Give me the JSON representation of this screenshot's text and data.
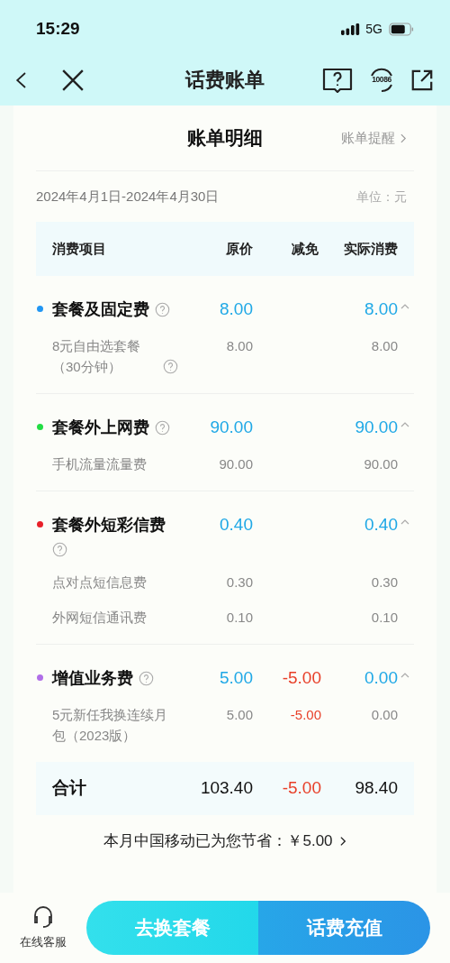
{
  "status_bar": {
    "time": "15:29",
    "network": "5G"
  },
  "nav": {
    "title": "话费账单",
    "service_number": "10086"
  },
  "bill": {
    "title": "账单明细",
    "reminder_link": "账单提醒",
    "period": "2024年4月1日-2024年4月30日",
    "unit": "单位：元",
    "columns": [
      "消费项目",
      "原价",
      "减免",
      "实际消费"
    ],
    "categories": [
      {
        "name": "套餐及固定费",
        "color": "#2196f3",
        "original": "8.00",
        "actual": "8.00",
        "expanded": true,
        "items": [
          {
            "name": "8元自由选套餐（30分钟）",
            "original": "8.00",
            "actual": "8.00",
            "help": true
          }
        ]
      },
      {
        "name": "套餐外上网费",
        "color": "#22dd44",
        "original": "90.00",
        "actual": "90.00",
        "expanded": true,
        "items": [
          {
            "name": "手机流量流量费",
            "original": "90.00",
            "actual": "90.00",
            "help": false
          }
        ]
      },
      {
        "name": "套餐外短彩信费",
        "color": "#e8202a",
        "original": "0.40",
        "actual": "0.40",
        "expanded": true,
        "items": [
          {
            "name": "点对点短信息费",
            "original": "0.30",
            "actual": "0.30",
            "help": false
          },
          {
            "name": "外网短信通讯费",
            "original": "0.10",
            "actual": "0.10",
            "help": false
          }
        ]
      },
      {
        "name": "增值业务费",
        "color": "#b06ee8",
        "original": "5.00",
        "discount": "-5.00",
        "actual": "0.00",
        "expanded": true,
        "items": [
          {
            "name": "5元新任我换连续月包（2023版）",
            "original": "5.00",
            "discount": "-5.00",
            "actual": "0.00",
            "help": false
          }
        ]
      }
    ],
    "total": {
      "label": "合计",
      "original": "103.40",
      "discount": "-5.00",
      "actual": "98.40"
    },
    "savings": "本月中国移动已为您节省：￥5.00"
  },
  "bottom_bar": {
    "service": "在线客服",
    "buttons": [
      "去换套餐",
      "话费充值"
    ]
  }
}
